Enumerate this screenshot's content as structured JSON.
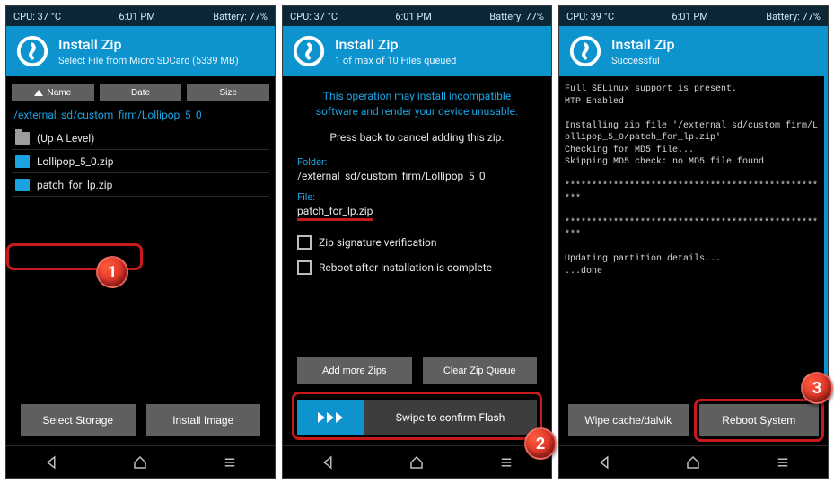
{
  "screen1": {
    "status": {
      "cpu": "CPU: 37 °C",
      "time": "6:01 PM",
      "battery": "Battery: 77%"
    },
    "header": {
      "title": "Install Zip",
      "subtitle": "Select File from Micro SDCard (5339 MB)"
    },
    "sort": {
      "name": "Name",
      "date": "Date",
      "size": "Size"
    },
    "path": "/external_sd/custom_firm/Lollipop_5_0",
    "rows": {
      "up": "(Up A Level)",
      "file1": "Lollipop_5_0.zip",
      "file2": "patch_for_lp.zip"
    },
    "buttons": {
      "selectStorage": "Select Storage",
      "installImage": "Install Image"
    }
  },
  "screen2": {
    "status": {
      "cpu": "CPU: 37 °C",
      "time": "6:01 PM",
      "battery": "Battery: 77%"
    },
    "header": {
      "title": "Install Zip",
      "subtitle": "1 of max of 10 Files queued"
    },
    "warn": "This operation may install incompatible\nsoftware and render your device unusable.",
    "info": "Press back to cancel adding this zip.",
    "folder_label": "Folder:",
    "folder_value": "/external_sd/custom_firm/Lollipop_5_0",
    "file_label": "File:",
    "file_value": "patch_for_lp.zip",
    "cb1": "Zip signature verification",
    "cb2": "Reboot after installation is complete",
    "addMore": "Add more Zips",
    "clearQueue": "Clear Zip Queue",
    "swipe": "Swipe to confirm Flash"
  },
  "screen3": {
    "status": {
      "cpu": "CPU: 39 °C",
      "time": "6:01 PM",
      "battery": "Battery: 77%"
    },
    "header": {
      "title": "Install Zip",
      "subtitle": "Successful"
    },
    "console": "Full SELinux support is present.\nMTP Enabled\n\nInstalling zip file '/external_sd/custom_firm/Lollipop_5_0/patch_for_lp.zip'\nChecking for MD5 file...\nSkipping MD5 check: no MD5 file found\n\n**************************************************\n\n**************************************************\n\nUpdating partition details...\n...done",
    "wipe": "Wipe cache/dalvik",
    "reboot": "Reboot System"
  },
  "callouts": {
    "c1": "1",
    "c2": "2",
    "c3": "3"
  }
}
